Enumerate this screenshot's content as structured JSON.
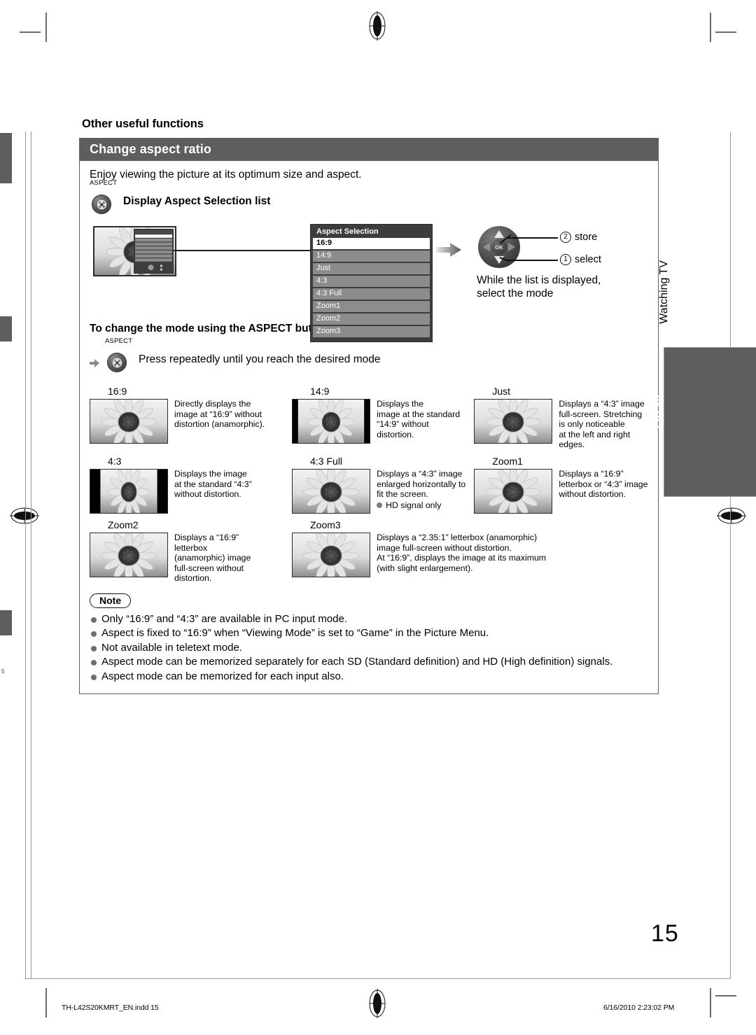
{
  "section": {
    "kicker": "Other useful functions",
    "panel_title": "Change aspect ratio",
    "lead": "Enjoy viewing the picture at its optimum size and aspect."
  },
  "step1": {
    "key_label": "ASPECT",
    "text": "Display Aspect Selection list"
  },
  "osd": {
    "title": "Aspect Selection",
    "items": [
      {
        "label": "16:9",
        "selected": true
      },
      {
        "label": "14:9",
        "selected": false
      },
      {
        "label": "Just",
        "selected": false
      },
      {
        "label": "4:3",
        "selected": false
      },
      {
        "label": "4:3 Full",
        "selected": false
      },
      {
        "label": "Zoom1",
        "selected": false
      },
      {
        "label": "Zoom2",
        "selected": false
      },
      {
        "label": "Zoom3",
        "selected": false
      }
    ]
  },
  "dpad": {
    "ok_label": "OK",
    "store_num": "2",
    "store_label": "store",
    "select_num": "1",
    "select_label": "select",
    "caption": "While the list is displayed,\nselect the mode"
  },
  "step2": {
    "heading": "To change the mode using the ASPECT button only",
    "key_label": "ASPECT",
    "text": "Press repeatedly until you reach the desired mode"
  },
  "modes": [
    {
      "name": "16:9",
      "desc": "Directly displays the\nimage at “16:9” without\ndistortion (anamorphic).",
      "pic": "full",
      "hd_only": false
    },
    {
      "name": "14:9",
      "desc": "Displays the\nimage at the standard\n“14:9” without\ndistortion.",
      "pic": "pillar-small",
      "hd_only": false
    },
    {
      "name": "Just",
      "desc": "Displays a “4:3” image\nfull-screen. Stretching\nis only noticeable\nat the left and right\nedges.",
      "pic": "full",
      "hd_only": false
    },
    {
      "name": "4:3",
      "desc": "Displays the image\nat the standard “4:3”\nwithout distortion.",
      "pic": "pillar-large",
      "hd_only": false
    },
    {
      "name": "4:3 Full",
      "desc": "Displays a “4:3” image\nenlarged horizontally to\nfit the screen.",
      "pic": "full",
      "hd_only": true,
      "hd_text": "HD signal only"
    },
    {
      "name": "Zoom1",
      "desc": "Displays a “16:9”\nletterbox or “4:3” image\nwithout distortion.",
      "pic": "full",
      "hd_only": false
    },
    {
      "name": "Zoom2",
      "desc": "Displays a “16:9”\nletterbox\n(anamorphic) image\nfull-screen without\ndistortion.",
      "pic": "full",
      "hd_only": false
    },
    {
      "name": "Zoom3",
      "desc": "Displays a “2.35:1” letterbox (anamorphic)\nimage full-screen without distortion.\nAt “16:9”, displays the image at its maximum\n(with slight enlargement).",
      "pic": "full",
      "hd_only": false,
      "wide_desc": true
    }
  ],
  "note": {
    "badge": "Note",
    "items": [
      "Only “16:9” and “4:3” are available in PC input mode.",
      "Aspect is fixed to “16:9” when “Viewing Mode” is set to “Game” in the Picture Menu.",
      "Not available in teletext mode.",
      "Aspect mode can be memorized separately for each SD (Standard definition) and HD (High definition) signals.",
      "Aspect mode can be memorized for each input also."
    ]
  },
  "side": {
    "chapter": "Watching TV",
    "tab": "Basic"
  },
  "page": {
    "number": "15",
    "footer_file": "TH-L42S20KMRT_EN.indd   15",
    "footer_date": "6/16/2010   2:23:02 PM"
  },
  "colors": {
    "panel_gray": "#5e5e5e",
    "osd_item_gray": "#8c8c8c",
    "bullet_gray": "#6e6e6e"
  }
}
